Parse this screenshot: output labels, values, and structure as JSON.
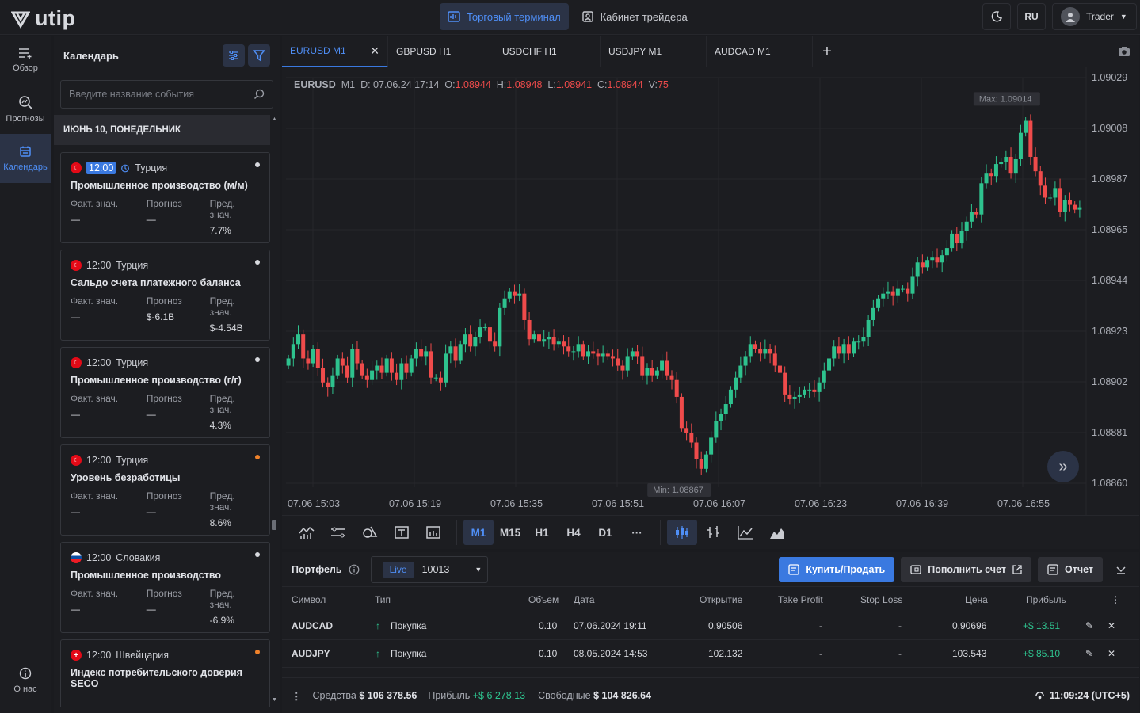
{
  "brand": {
    "name": "utip"
  },
  "topnav": {
    "terminal": "Торговый терминал",
    "cabinet": "Кабинет трейдера"
  },
  "topright": {
    "lang": "RU",
    "user": "Trader"
  },
  "leftnav": {
    "overview": "Обзор",
    "forecasts": "Прогнозы",
    "calendar": "Календарь",
    "about": "О нас"
  },
  "calendar": {
    "title": "Календарь",
    "search_placeholder": "Введите название события",
    "day": "ИЮНЬ 10, ПОНЕДЕЛЬНИК",
    "col_actual": "Факт. знач.",
    "col_forecast": "Прогноз",
    "col_prev": "Пред. знач.",
    "events": [
      {
        "time": "12:00",
        "country": "Турция",
        "title": "Промышленное производство (м/м)",
        "actual": "—",
        "forecast": "—",
        "prev": "7.7%"
      },
      {
        "time": "12:00",
        "country": "Турция",
        "title": "Сальдо счета платежного баланса",
        "actual": "—",
        "forecast": "$-6.1B",
        "prev": "$-4.54B"
      },
      {
        "time": "12:00",
        "country": "Турция",
        "title": "Промышленное производство (г/г)",
        "actual": "—",
        "forecast": "—",
        "prev": "4.3%"
      },
      {
        "time": "12:00",
        "country": "Турция",
        "title": "Уровень безработицы",
        "actual": "—",
        "forecast": "—",
        "prev": "8.6%"
      },
      {
        "time": "12:00",
        "country": "Словакия",
        "title": "Промышленное производство",
        "actual": "—",
        "forecast": "—",
        "prev": "-6.9%"
      },
      {
        "time": "12:00",
        "country": "Швейцария",
        "title": "Индекс потребительского доверия SECO",
        "actual": "",
        "forecast": "",
        "prev": ""
      }
    ]
  },
  "tabs": [
    "EURUSD M1",
    "GBPUSD H1",
    "USDCHF H1",
    "USDJPY M1",
    "AUDCAD M1"
  ],
  "ohlc": {
    "symbol": "EURUSD",
    "tf": "M1",
    "date": "D: 07.06.24 17:14",
    "o_label": "O:",
    "o": "1.08944",
    "h_label": "H:",
    "h": "1.08948",
    "l_label": "L:",
    "l": "1.08941",
    "c_label": "C:",
    "c": "1.08944",
    "v_label": "V:",
    "v": "75"
  },
  "chart_data": {
    "type": "candlestick",
    "y_ticks": [
      "1.09029",
      "1.09008",
      "1.08987",
      "1.08965",
      "1.08944",
      "1.08923",
      "1.08902",
      "1.08881",
      "1.08860"
    ],
    "x_ticks": [
      "07.06 15:03",
      "07.06 15:19",
      "07.06 15:35",
      "07.06 15:51",
      "07.06 16:07",
      "07.06 16:23",
      "07.06 16:39",
      "07.06 16:55"
    ],
    "max_label": "Max: 1.09014",
    "min_label": "Min: 1.08867",
    "ylim": [
      1.0886,
      1.09029
    ],
    "closes": [
      1.08912,
      1.08918,
      1.08922,
      1.08912,
      1.0891,
      1.08916,
      1.08908,
      1.08902,
      1.089,
      1.08905,
      1.08912,
      1.08909,
      1.08904,
      1.08916,
      1.0891,
      1.08905,
      1.08903,
      1.08907,
      1.08909,
      1.08906,
      1.08912,
      1.08906,
      1.08903,
      1.0891,
      1.08906,
      1.08912,
      1.08916,
      1.08913,
      1.08915,
      1.08904,
      1.08904,
      1.08902,
      1.08914,
      1.08917,
      1.08911,
      1.08918,
      1.08922,
      1.08917,
      1.08921,
      1.08925,
      1.08925,
      1.08919,
      1.08917,
      1.08933,
      1.08937,
      1.0894,
      1.08938,
      1.08939,
      1.08928,
      1.0892,
      1.08922,
      1.08919,
      1.0892,
      1.08921,
      1.08918,
      1.08919,
      1.08917,
      1.08915,
      1.08915,
      1.08918,
      1.08913,
      1.08915,
      1.08914,
      1.08913,
      1.08914,
      1.08913,
      1.08912,
      1.08909,
      1.08907,
      1.08913,
      1.08915,
      1.08913,
      1.08905,
      1.08908,
      1.08905,
      1.08907,
      1.08911,
      1.08905,
      1.08903,
      1.08896,
      1.08883,
      1.08881,
      1.08877,
      1.0887,
      1.08866,
      1.08872,
      1.08879,
      1.08886,
      1.08889,
      1.08893,
      1.08899,
      1.08904,
      1.08909,
      1.08913,
      1.08918,
      1.08916,
      1.08914,
      1.08916,
      1.08914,
      1.08909,
      1.08906,
      1.08897,
      1.08895,
      1.08896,
      1.08897,
      1.08899,
      1.08899,
      1.08898,
      1.08902,
      1.08907,
      1.08912,
      1.08917,
      1.08914,
      1.08918,
      1.08914,
      1.08919,
      1.08919,
      1.08921,
      1.08928,
      1.08933,
      1.08937,
      1.08939,
      1.0894,
      1.08938,
      1.08941,
      1.08941,
      1.08939,
      1.08946,
      1.08952,
      1.0895,
      1.08953,
      1.08954,
      1.08952,
      1.08955,
      1.08958,
      1.08964,
      1.0896,
      1.08965,
      1.08969,
      1.08973,
      1.08972,
      1.08985,
      1.08989,
      1.08988,
      1.08993,
      1.08994,
      1.08996,
      1.08989,
      1.08995,
      1.09006,
      1.09011,
      1.08996,
      1.0899,
      1.08984,
      1.08979,
      1.08979,
      1.08983,
      1.08973,
      1.08978,
      1.08976,
      1.08974,
      1.08975
    ]
  },
  "chart_toolbar": {
    "m1": "M1",
    "m15": "M15",
    "h1": "H1",
    "h4": "H4",
    "d1": "D1",
    "more": "···"
  },
  "portfolio": {
    "title": "Портфель",
    "live": "Live",
    "account": "10013",
    "buy_sell": "Купить/Продать",
    "deposit": "Пополнить счет",
    "report": "Отчет",
    "headers": {
      "symbol": "Символ",
      "type": "Тип",
      "volume": "Объем",
      "date": "Дата",
      "open": "Открытие",
      "tp": "Take Profit",
      "sl": "Stop Loss",
      "price": "Цена",
      "profit": "Прибыль"
    },
    "rows": [
      {
        "symbol": "AUDCAD",
        "type": "Покупка",
        "volume": "0.10",
        "date": "07.06.2024 19:11",
        "open": "0.90506",
        "tp": "-",
        "sl": "-",
        "price": "0.90696",
        "profit": "+$ 13.51"
      },
      {
        "symbol": "AUDJPY",
        "type": "Покупка",
        "volume": "0.10",
        "date": "08.05.2024 14:53",
        "open": "102.132",
        "tp": "-",
        "sl": "-",
        "price": "103.543",
        "profit": "+$ 85.10"
      }
    ]
  },
  "footer": {
    "equity_label": "Средства",
    "equity": "$ 106 378.56",
    "profit_label": "Прибыль",
    "profit": "+$ 6 278.13",
    "free_label": "Свободные",
    "free": "$ 104 826.64",
    "time": "11:09:24 (UTC+5)"
  },
  "colors": {
    "up": "#2ec28e",
    "down": "#ef4b4b",
    "accent": "#3a79e0"
  }
}
